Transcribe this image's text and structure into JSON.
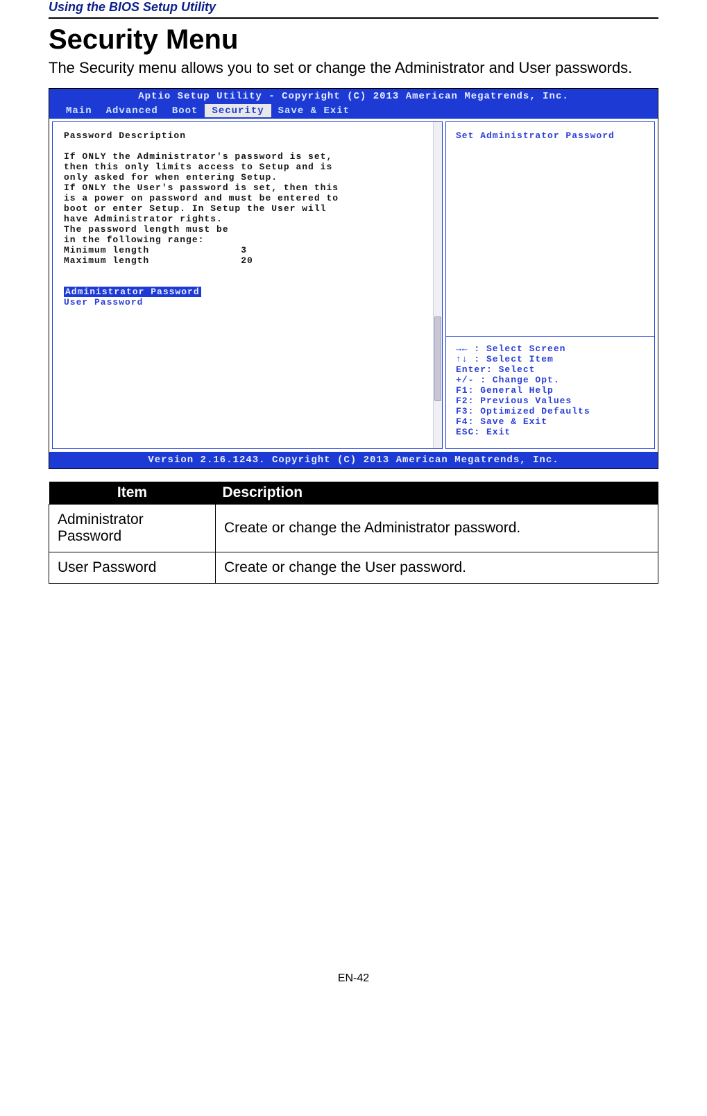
{
  "doc": {
    "header": "Using the BIOS Setup Utility",
    "section_title": "Security Menu",
    "intro": "The Security menu allows you to set or change the Administrator and User passwords.",
    "page_number": "EN-42"
  },
  "bios": {
    "top_bar": "Aptio Setup Utility - Copyright (C) 2013 American Megatrends, Inc.",
    "bottom_bar": "Version 2.16.1243. Copyright (C) 2013 American Megatrends, Inc.",
    "tabs": [
      "Main",
      "Advanced",
      "Boot",
      "Security",
      "Save & Exit"
    ],
    "active_tab_index": 3,
    "left": {
      "title": "Password Description",
      "body_lines": [
        "If ONLY the Administrator's password is set,",
        "then this only limits access to Setup and is",
        "only asked for when entering Setup.",
        "If ONLY the User's password is set, then this",
        "is a power on password and must be entered to",
        "boot or enter Setup. In Setup the User will",
        "have Administrator rights.",
        "The password length must be",
        "in the following range:"
      ],
      "min_label": "Minimum length",
      "min_value": "3",
      "max_label": "Maximum length",
      "max_value": "20",
      "selected_item": "Administrator Password",
      "link_item": "User Password"
    },
    "right": {
      "help_title": "Set Administrator Password",
      "keys": [
        "→← : Select Screen",
        "↑↓ : Select Item",
        "Enter: Select",
        "+/- : Change Opt.",
        "F1: General Help",
        "F2: Previous Values",
        "F3: Optimized Defaults",
        "F4: Save & Exit",
        "ESC: Exit"
      ]
    }
  },
  "table": {
    "headers": {
      "item": "Item",
      "description": "Description"
    },
    "rows": [
      {
        "item": "Administrator Password",
        "description": "Create or change the Administrator password."
      },
      {
        "item": "User Password",
        "description": "Create or change the User password."
      }
    ]
  }
}
